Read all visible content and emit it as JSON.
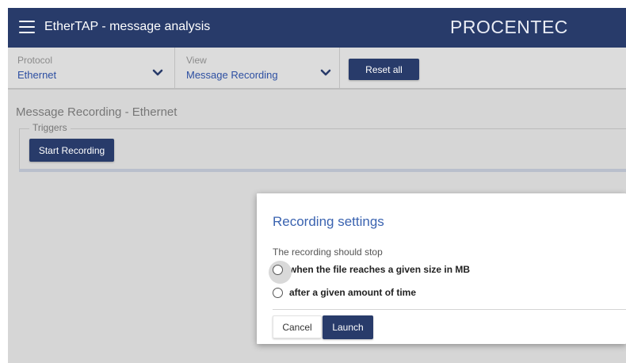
{
  "app": {
    "title": "EtherTAP - message analysis",
    "brand": "PROCENTEC"
  },
  "toolbar": {
    "protocol": {
      "label": "Protocol",
      "value": "Ethernet"
    },
    "view": {
      "label": "View",
      "value": "Message Recording"
    },
    "reset_label": "Reset all"
  },
  "main": {
    "section_title": "Message Recording - Ethernet",
    "triggers_legend": "Triggers",
    "start_recording_label": "Start Recording"
  },
  "dialog": {
    "title": "Recording settings",
    "text": "The recording should stop",
    "options": [
      {
        "label": "when the file reaches a given size in MB",
        "selected": false
      },
      {
        "label": "after a given amount of time",
        "selected": false
      }
    ],
    "cancel_label": "Cancel",
    "launch_label": "Launch"
  },
  "colors": {
    "primary": "#283b6a",
    "accent_text": "#2d4fa2",
    "dialog_title": "#3a63b0"
  },
  "icons": {
    "menu": "hamburger-menu-icon",
    "dropdown": "chevron-down-icon"
  }
}
